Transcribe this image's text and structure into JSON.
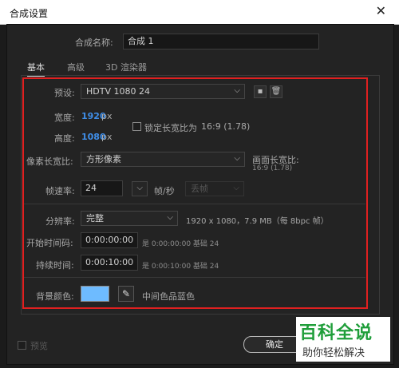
{
  "window": {
    "title": "合成设置",
    "close_icon": "close-icon"
  },
  "comp_name": {
    "label": "合成名称:",
    "value": "合成 1"
  },
  "tabs": [
    {
      "label": "基本",
      "active": true
    },
    {
      "label": "高级",
      "active": false
    },
    {
      "label": "3D 渲染器",
      "active": false
    }
  ],
  "preset": {
    "label": "预设:",
    "value": "HDTV 1080 24"
  },
  "width": {
    "label": "宽度:",
    "value": "1920",
    "unit": "px"
  },
  "height": {
    "label": "高度:",
    "value": "1080",
    "unit": "px"
  },
  "lock_aspect": {
    "label": "锁定长宽比为",
    "ratio": "16:9 (1.78)",
    "checked": false
  },
  "pixel_aspect": {
    "label": "像素长宽比:",
    "value": "方形像素"
  },
  "frame_aspect": {
    "label": "画面长宽比:",
    "value": "16:9 (1.78)"
  },
  "frame_rate": {
    "label": "帧速率:",
    "value": "24",
    "unit": "帧/秒",
    "drop_frame": "丢帧"
  },
  "resolution": {
    "label": "分辨率:",
    "value": "完整",
    "info": "1920 x 1080，7.9 MB（每 8bpc 帧）"
  },
  "start_timecode": {
    "label": "开始时间码:",
    "value": "0:00:00:00",
    "info": "是 0:00:00:00  基础 24"
  },
  "duration": {
    "label": "持续时间:",
    "value": "0:00:10:00",
    "info": "是 0:00:10:00  基础 24"
  },
  "background": {
    "label": "背景颜色:",
    "color": "#6ebbff",
    "name": "中间色品蓝色"
  },
  "footer": {
    "preview_label": "预览",
    "ok_label": "确定"
  },
  "watermark": {
    "line1": "百科全说",
    "line2": "助你轻松解决"
  },
  "colors": {
    "highlight_box": "#e02020",
    "value_blue": "#3f8ee8",
    "dialog_bg": "#232323"
  }
}
